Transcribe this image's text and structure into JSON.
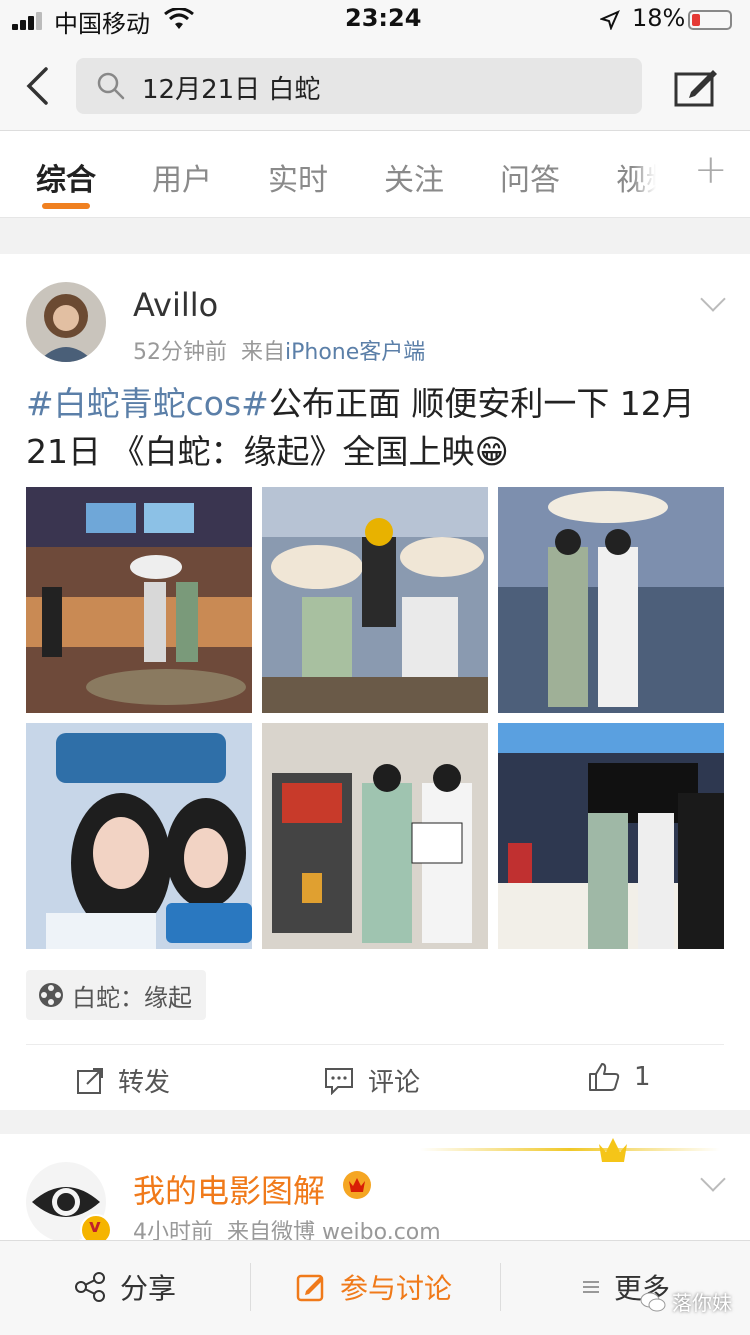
{
  "status_bar": {
    "carrier": "中国移动",
    "time": "23:24",
    "battery": "18%"
  },
  "search": {
    "query": "12月21日 白蛇"
  },
  "tabs": [
    {
      "label": "综合",
      "active": true
    },
    {
      "label": "用户"
    },
    {
      "label": "实时"
    },
    {
      "label": "关注"
    },
    {
      "label": "问答"
    },
    {
      "label": "视频"
    }
  ],
  "post1": {
    "username": "Avillo",
    "time": "52分钟前",
    "source_prefix": "来自",
    "source": "iPhone客户端",
    "hashtag": "#白蛇青蛇cos#",
    "text": "公布正面  顺便安利一下 12月21日 《白蛇：缘起》全国上映",
    "emoji": "😁",
    "photos": [
      "cinema-lobby-photo",
      "umbrella-group-photo",
      "standing-duo-photo",
      "selfie-photo",
      "soda-fountain-photo",
      "counter-photo"
    ],
    "topic": "白蛇：缘起",
    "actions": {
      "repost": "转发",
      "comment": "评论",
      "like_count": "1"
    }
  },
  "post2": {
    "username": "我的电影图解",
    "time": "4小时前",
    "source_prefix": "来自微博",
    "source": "weibo.com"
  },
  "bottom_bar": {
    "share": "分享",
    "discuss": "参与讨论",
    "more": "更多",
    "watermark": "落你妹"
  },
  "colors": {
    "accent": "#f08020",
    "link": "#5b7fa8"
  }
}
